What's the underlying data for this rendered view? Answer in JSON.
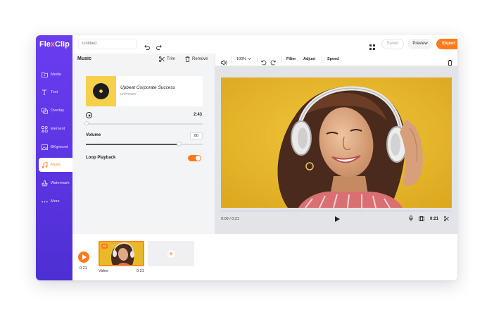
{
  "app": {
    "logo_prefix": "Fle",
    "logo_x": "x",
    "logo_suffix": "Clip",
    "accent": "#ff7a1a",
    "sidebar_color": "#5a34e0"
  },
  "sidebar": {
    "items": [
      {
        "label": "Media",
        "icon": "folder-icon"
      },
      {
        "label": "Text",
        "icon": "text-icon"
      },
      {
        "label": "Overlay",
        "icon": "overlay-icon"
      },
      {
        "label": "Element",
        "icon": "element-icon"
      },
      {
        "label": "BKground",
        "icon": "background-icon"
      },
      {
        "label": "Music",
        "icon": "music-icon",
        "active": true
      },
      {
        "label": "Watermark",
        "icon": "watermark-icon"
      },
      {
        "label": "More",
        "icon": "more-icon"
      }
    ]
  },
  "topbar": {
    "title_placeholder": "Untitled",
    "saved_label": "Saved",
    "preview_label": "Preview",
    "export_label": "Export"
  },
  "panel": {
    "title": "Music",
    "trim_label": "Trim",
    "remove_label": "Remove",
    "track_title": "Upbeat Corporate Success",
    "track_artist": "unknown",
    "duration": "2:43",
    "volume_label": "Volume",
    "volume_value": "80",
    "volume_fraction": 0.8,
    "loop_label": "Loop Playback",
    "loop_on": true
  },
  "preview": {
    "zoom": "100%",
    "filter_label": "Filter",
    "adjust_label": "Adjust",
    "speed_label": "Speed",
    "current_time": "0:00 / 0:21",
    "total_time": "0:21"
  },
  "timeline": {
    "time": "0:21",
    "clip_number": "01",
    "clip_label": "Video",
    "clip_duration": "0:21"
  }
}
